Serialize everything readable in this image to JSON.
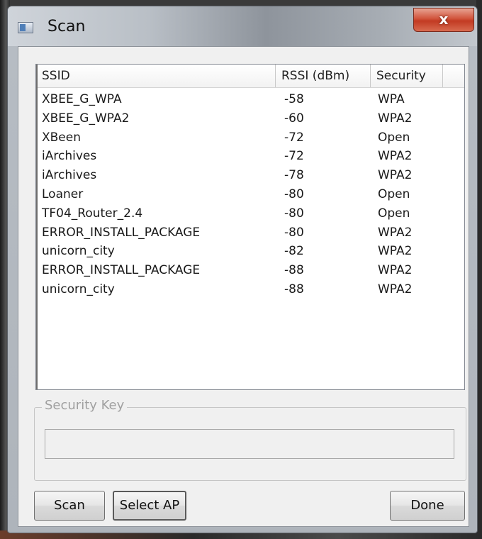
{
  "window": {
    "title": "Scan",
    "close_label": "x"
  },
  "list": {
    "columns": [
      "SSID",
      "RSSI (dBm)",
      "Security"
    ],
    "rows": [
      {
        "ssid": "XBEE_G_WPA",
        "rssi": "-58",
        "security": "WPA"
      },
      {
        "ssid": "XBEE_G_WPA2",
        "rssi": "-60",
        "security": "WPA2"
      },
      {
        "ssid": "XBeen",
        "rssi": "-72",
        "security": "Open"
      },
      {
        "ssid": "iArchives",
        "rssi": "-72",
        "security": "WPA2"
      },
      {
        "ssid": "iArchives",
        "rssi": "-78",
        "security": "WPA2"
      },
      {
        "ssid": "Loaner",
        "rssi": "-80",
        "security": "Open"
      },
      {
        "ssid": "TF04_Router_2.4",
        "rssi": "-80",
        "security": "Open"
      },
      {
        "ssid": "ERROR_INSTALL_PACKAGE",
        "rssi": "-80",
        "security": "WPA2"
      },
      {
        "ssid": "unicorn_city",
        "rssi": "-82",
        "security": "WPA2"
      },
      {
        "ssid": "ERROR_INSTALL_PACKAGE",
        "rssi": "-88",
        "security": "WPA2"
      },
      {
        "ssid": "unicorn_city",
        "rssi": "-88",
        "security": "WPA2"
      }
    ]
  },
  "security_key": {
    "label": "Security Key",
    "value": ""
  },
  "buttons": {
    "scan": "Scan",
    "select_ap": "Select AP",
    "done": "Done"
  }
}
